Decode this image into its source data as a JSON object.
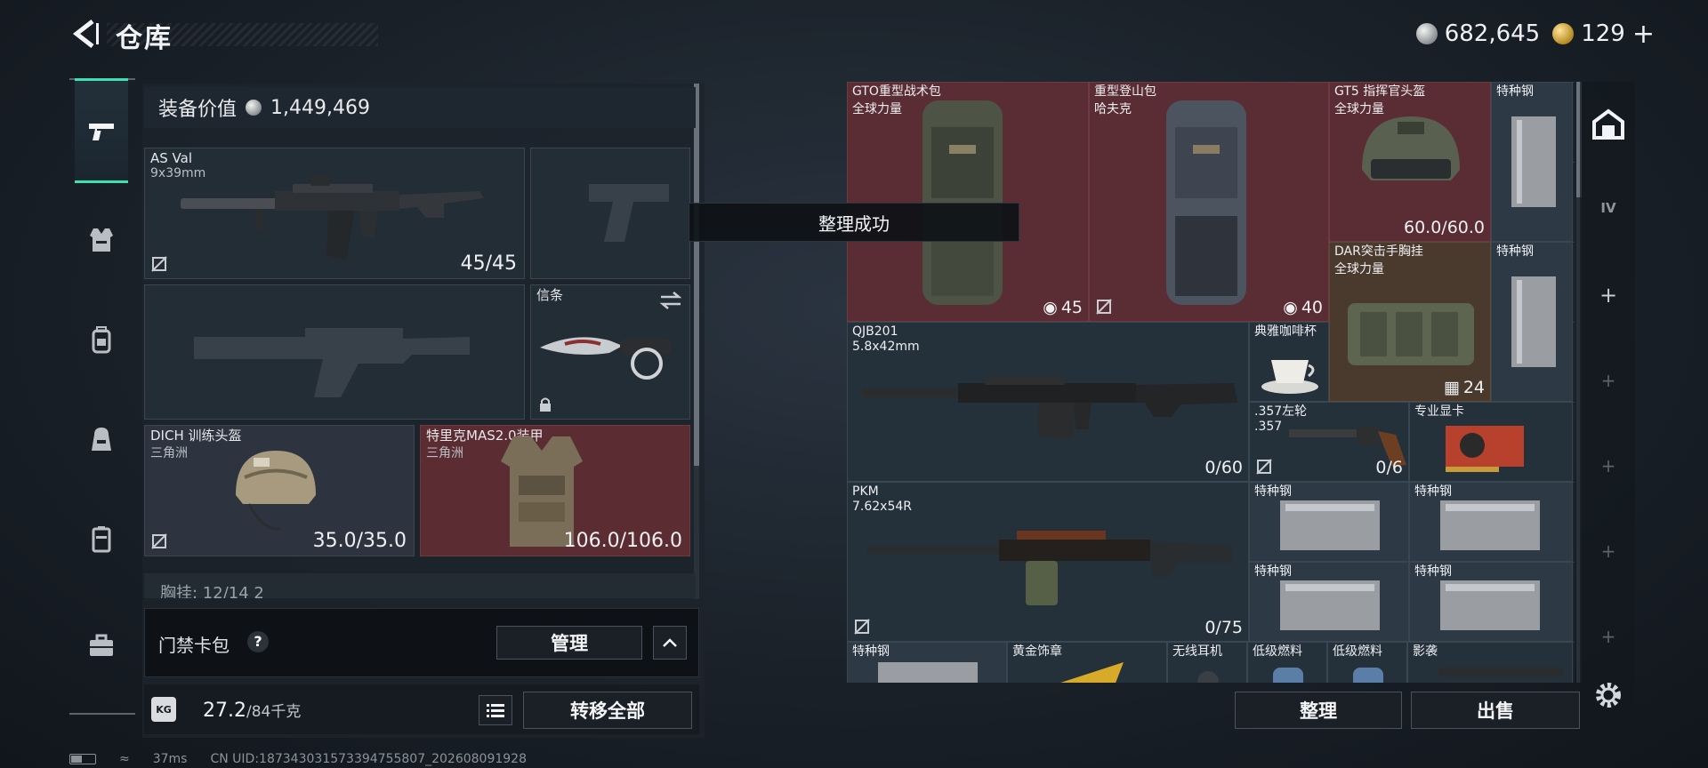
{
  "header": {
    "title": "仓库",
    "currency": [
      {
        "icon": "silver-coin-icon",
        "value": "682,645"
      },
      {
        "icon": "gold-coin-icon",
        "value": "129"
      }
    ],
    "add_symbol": "+"
  },
  "left_tabs": [
    {
      "icon": "pistol-icon",
      "active": true
    },
    {
      "icon": "armor-vest-icon",
      "active": false
    },
    {
      "icon": "backpack-icon",
      "active": false
    },
    {
      "icon": "bag-icon",
      "active": false
    },
    {
      "icon": "case-icon",
      "active": false
    },
    {
      "icon": "toolbox-icon",
      "active": false
    }
  ],
  "equipment": {
    "value_label": "装备价值",
    "value": "1,449,469",
    "primary_weapon": {
      "name": "AS Val",
      "caliber": "9x39mm",
      "ammo": "45/45"
    },
    "melee": {
      "label": "信条"
    },
    "helmet": {
      "name": "DICH 训练头盔",
      "brand": "三角洲",
      "durability": "35.0/35.0"
    },
    "armor": {
      "name": "特里克MAS2.0装甲",
      "brand": "三角洲",
      "durability": "106.0/106.0"
    },
    "chest_rig_peek": "胸挂: 12/14 2",
    "access_card": {
      "label": "门禁卡包",
      "help": "?",
      "manage": "管理"
    },
    "weight": {
      "current": "27.2",
      "max": "/84千克",
      "icon_label": "KG"
    },
    "transfer_all": "转移全部"
  },
  "toast": "整理成功",
  "stash": {
    "items": [
      {
        "key": "gto",
        "name": "GTO重型战术包",
        "sub": "全球力量",
        "count": "45"
      },
      {
        "key": "hike",
        "name": "重型登山包",
        "sub": "哈夫克",
        "count": "40"
      },
      {
        "key": "gt5",
        "name": "GT5 指挥官头盔",
        "sub": "全球力量",
        "value": "60.0/60.0"
      },
      {
        "key": "steel1",
        "name": "特种钢"
      },
      {
        "key": "dar",
        "name": "DAR突击手胸挂",
        "sub": "全球力量",
        "count": "24"
      },
      {
        "key": "steel2",
        "name": "特种钢"
      },
      {
        "key": "qjb",
        "name": "QJB201",
        "sub": "5.8x42mm",
        "value": "0/60"
      },
      {
        "key": "cup",
        "name": "典雅咖啡杯"
      },
      {
        "key": "revolver",
        "name": ".357左轮",
        "sub": ".357",
        "value": "0/6"
      },
      {
        "key": "gpu",
        "name": "专业显卡"
      },
      {
        "key": "pkm",
        "name": "PKM",
        "sub": "7.62x54R",
        "value": "0/75"
      },
      {
        "key": "steel3",
        "name": "特种钢"
      },
      {
        "key": "steel4",
        "name": "特种钢"
      },
      {
        "key": "steel5",
        "name": "特种钢"
      },
      {
        "key": "steel6",
        "name": "特种钢"
      },
      {
        "key": "steel7",
        "name": "特种钢"
      },
      {
        "key": "medal",
        "name": "黄金饰章"
      },
      {
        "key": "earbuds",
        "name": "无线耳机"
      },
      {
        "key": "fuel1",
        "name": "低级燃料"
      },
      {
        "key": "fuel2",
        "name": "低级燃料"
      },
      {
        "key": "shadow",
        "name": "影袭"
      }
    ],
    "sort_button": "整理",
    "sell_button": "出售"
  },
  "right_tools": [
    {
      "icon": "stash-home-icon"
    },
    {
      "icon": "tier-iv-icon",
      "label": "IV"
    },
    {
      "icon": "add-icon",
      "label": "+"
    },
    {
      "icon": "add-icon",
      "label": "+"
    },
    {
      "icon": "add-icon",
      "label": "+"
    },
    {
      "icon": "add-icon",
      "label": "+"
    },
    {
      "icon": "add-icon",
      "label": "+"
    },
    {
      "icon": "settings-gear-icon"
    }
  ],
  "footer": {
    "ping": "37ms",
    "uid": "CN UID:187343031573394755807_202608091928"
  },
  "colors": {
    "accent_teal": "#3de1b0",
    "rarity_red": "#5a2c33",
    "rarity_gold": "#4a3a2e",
    "slot_dark": "#24303a"
  }
}
